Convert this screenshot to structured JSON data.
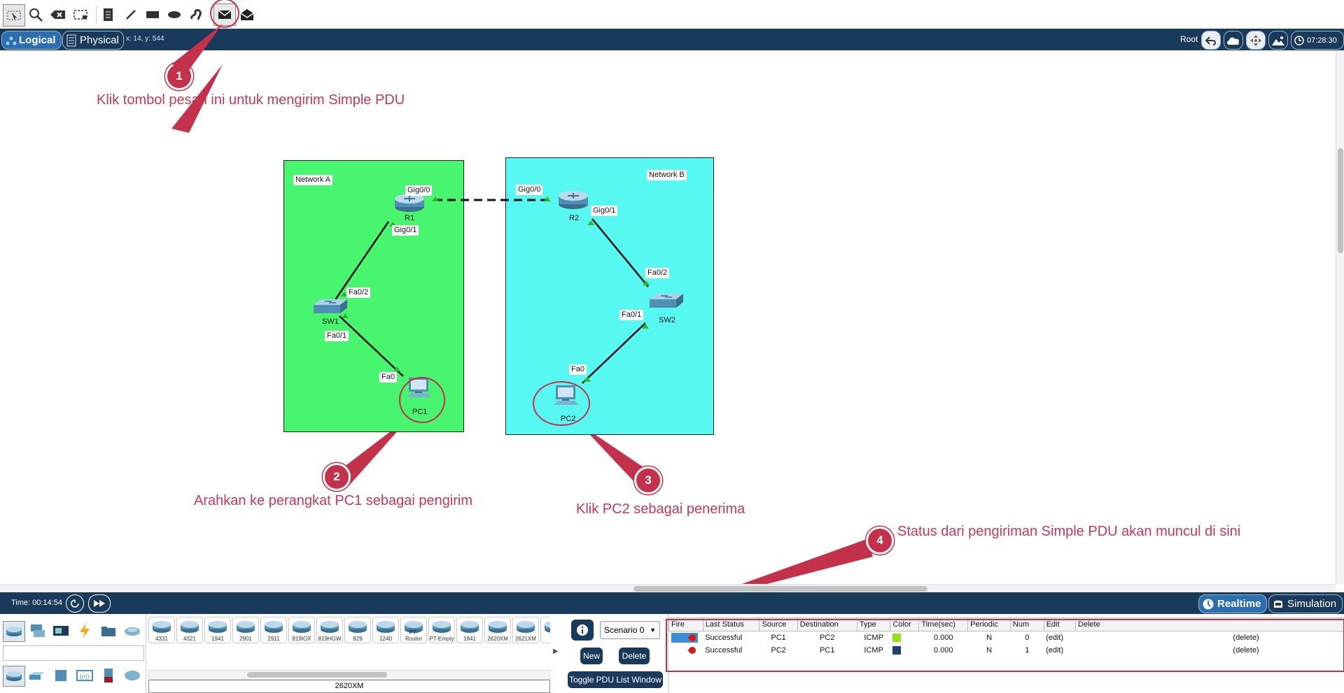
{
  "toolbar": {
    "items": [
      "select-icon",
      "inspect-icon",
      "delete-icon",
      "resize-icon",
      "note-icon",
      "line-icon",
      "rectangle-icon",
      "ellipse-icon",
      "freeform-icon",
      "simple-pdu-icon",
      "complex-pdu-icon"
    ]
  },
  "header": {
    "tab_logical": "Logical",
    "tab_physical": "Physical",
    "coords": "x: 14, y: 544",
    "root_label": "Root",
    "clock": "07:28:30"
  },
  "diagram": {
    "network_a": "Network A",
    "network_b": "Network B",
    "r1": {
      "name": "R1",
      "port_top": "Gig0/0",
      "port_bottom": "Gig0/1"
    },
    "r2": {
      "name": "R2",
      "port_left": "Gig0/0",
      "port_bottom": "Gig0/1"
    },
    "sw1": {
      "name": "SW1",
      "port_up": "Fa0/2",
      "port_down": "Fa0/1"
    },
    "sw2": {
      "name": "SW2",
      "port_up": "Fa0/2",
      "port_down": "Fa0/1"
    },
    "pc1": {
      "name": "PC1",
      "port": "Fa0"
    },
    "pc2": {
      "name": "PC2",
      "port": "Fa0"
    }
  },
  "annotations": {
    "a1": {
      "num": "1",
      "text": "Klik tombol pesan ini untuk mengirim Simple PDU"
    },
    "a2": {
      "num": "2",
      "text": "Arahkan ke perangkat PC1 sebagai pengirim"
    },
    "a3": {
      "num": "3",
      "text": "Klik PC2 sebagai penerima"
    },
    "a4": {
      "num": "4",
      "text": "Status dari pengiriman Simple PDU akan muncul di sini"
    }
  },
  "timebar": {
    "time": "Time: 00:14:54",
    "realtime": "Realtime",
    "simulation": "Simulation"
  },
  "device_panel": {
    "models": [
      "4331",
      "4321",
      "1941",
      "2901",
      "2911",
      "819IOX",
      "819HGW",
      "829",
      "1240",
      "PT-Router",
      "PT-Empty",
      "1841",
      "2620XM",
      "2621XM",
      "2..."
    ],
    "selected_model": "2620XM"
  },
  "pdu_controls": {
    "scenario": "Scenario 0",
    "new": "New",
    "delete": "Delete",
    "toggle": "Toggle PDU List Window"
  },
  "pdu_table": {
    "headers": [
      "Fire",
      "Last Status",
      "Source",
      "Destination",
      "Type",
      "Color",
      "Time(sec)",
      "Periodic",
      "Num",
      "Edit",
      "Delete"
    ],
    "rows": [
      {
        "status": "Successful",
        "source": "PC1",
        "dest": "PC2",
        "type": "ICMP",
        "color": "#8fe21c",
        "time": "0.000",
        "periodic": "N",
        "num": "0",
        "edit": "(edit)",
        "delete": "(delete)"
      },
      {
        "status": "Successful",
        "source": "PC2",
        "dest": "PC1",
        "type": "ICMP",
        "color": "#1f3f6e",
        "time": "0.000",
        "periodic": "N",
        "num": "1",
        "edit": "(edit)",
        "delete": "(delete)"
      }
    ]
  },
  "colors": {
    "network_a_bg": "#47f56f",
    "network_b_bg": "#57f7f2",
    "header_bg": "#1a3a5c",
    "annotation": "#c4314b"
  }
}
